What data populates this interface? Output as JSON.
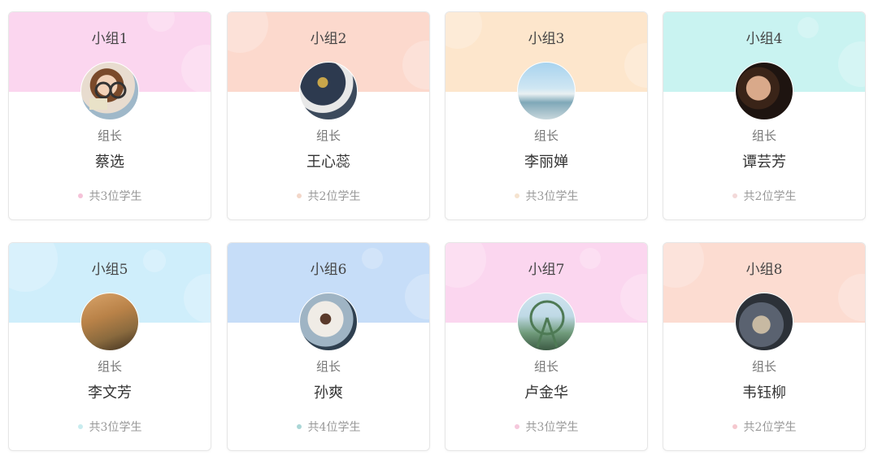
{
  "groups": [
    {
      "title": "小组1",
      "role": "组长",
      "leader": "蔡选",
      "count": "共3位学生",
      "banner": "#fbd6ef",
      "dot": "#f5c2d8"
    },
    {
      "title": "小组2",
      "role": "组长",
      "leader": "王心蕊",
      "count": "共2位学生",
      "banner": "#fcd9cd",
      "dot": "#f3d7c9"
    },
    {
      "title": "小组3",
      "role": "组长",
      "leader": "李丽婵",
      "count": "共3位学生",
      "banner": "#fde6cc",
      "dot": "#f5e3cf"
    },
    {
      "title": "小组4",
      "role": "组长",
      "leader": "谭芸芳",
      "count": "共2位学生",
      "banner": "#c9f3f1",
      "dot": "#f3d9d9"
    },
    {
      "title": "小组5",
      "role": "组长",
      "leader": "李文芳",
      "count": "共3位学生",
      "banner": "#cfeefb",
      "dot": "#c8ecef"
    },
    {
      "title": "小组6",
      "role": "组长",
      "leader": "孙爽",
      "count": "共4位学生",
      "banner": "#c6ddf8",
      "dot": "#aad6d6"
    },
    {
      "title": "小组7",
      "role": "组长",
      "leader": "卢金华",
      "count": "共3位学生",
      "banner": "#fbd6ef",
      "dot": "#f5c8dc"
    },
    {
      "title": "小组8",
      "role": "组长",
      "leader": "韦钰柳",
      "count": "共2位学生",
      "banner": "#fcdcd1",
      "dot": "#f5c8cf"
    }
  ]
}
